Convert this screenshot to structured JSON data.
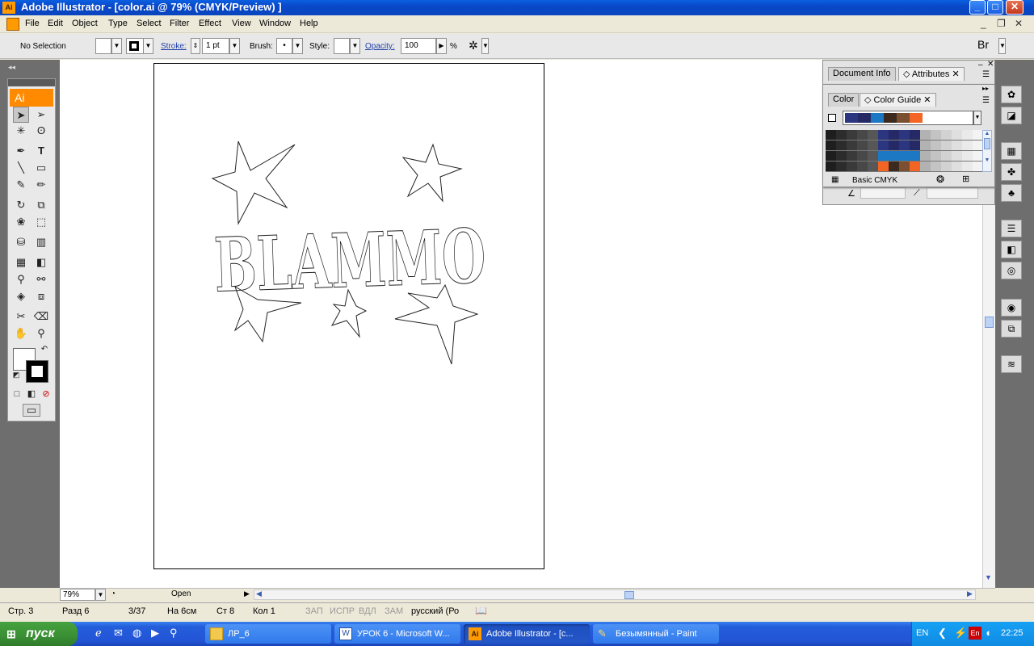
{
  "window": {
    "title": "Adobe Illustrator - [color.ai @ 79% (CMYK/Preview) ]",
    "min": "_",
    "max": "□",
    "close": "✕"
  },
  "menu": [
    "File",
    "Edit",
    "Object",
    "Type",
    "Select",
    "Filter",
    "Effect",
    "View",
    "Window",
    "Help"
  ],
  "control": {
    "selection": "No Selection",
    "stroke_label": "Stroke:",
    "stroke_value": "1 pt",
    "brush_label": "Brush:",
    "style_label": "Style:",
    "opacity_label": "Opacity:",
    "opacity_value": "100",
    "opacity_unit": "%"
  },
  "toolbox": {
    "logo": "Ai"
  },
  "panels": {
    "top_tabs": [
      "Document Info",
      "Attributes"
    ],
    "color_tabs": [
      "Color",
      "Color Guide"
    ],
    "library_name": "Basic CMYK",
    "harmony_colors": [
      "#2b3580",
      "#252a66",
      "#1c78c2",
      "#3d2a1e",
      "#7a5030",
      "#f26524"
    ]
  },
  "artwork": {
    "text": "BLAMMO"
  },
  "ai_status": {
    "zoom": "79%",
    "state": "Open"
  },
  "word_status": {
    "page": "Стр. 3",
    "section": "Разд 6",
    "pages": "3/37",
    "at": "На 6см",
    "line": "Ст 8",
    "col": "Кол 1",
    "rec": "ЗАП",
    "trk": "ИСПР",
    "ext": "ВДЛ",
    "ovr": "ЗАМ",
    "lang": "русский (Ро"
  },
  "taskbar": {
    "start": "пуск",
    "tasks": [
      "ЛР_6",
      "УРОК 6 - Microsoft W...",
      "Adobe Illustrator - [c...",
      "Безымянный - Paint"
    ],
    "lang": "EN",
    "clock": "22:25"
  }
}
